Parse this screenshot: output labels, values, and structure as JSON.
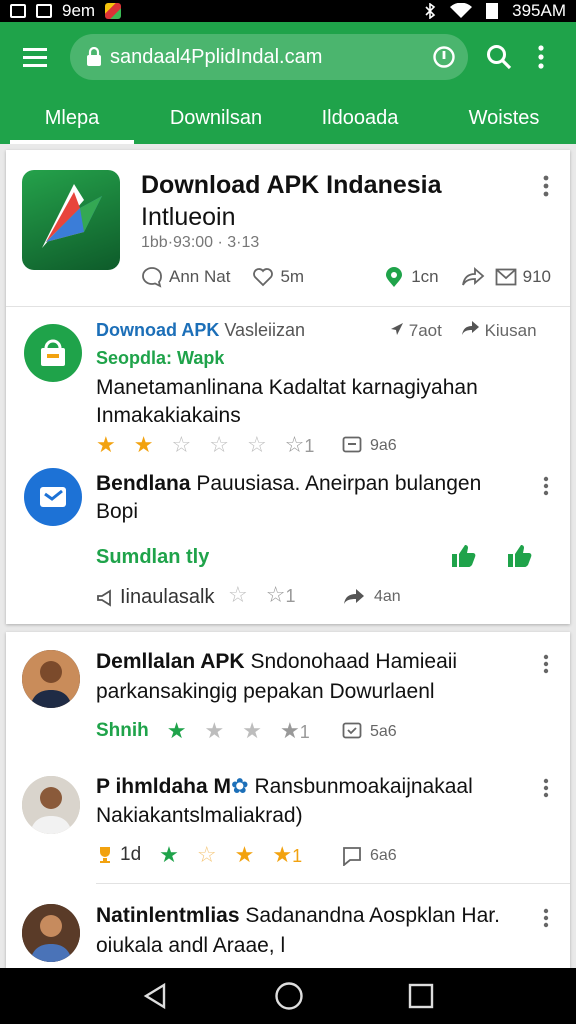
{
  "status": {
    "left_text": "9em",
    "time": "395AM"
  },
  "toolbar": {
    "url": "sandaal4PplidIndal.cam"
  },
  "tabs": [
    {
      "label": "Mlepa"
    },
    {
      "label": "Downilsan"
    },
    {
      "label": "Ildooada"
    },
    {
      "label": "Woistes"
    }
  ],
  "featured": {
    "title": "Download APK  Indanesia",
    "subtitle": "Intlueoin",
    "meta": "1bb·93:00 · 3·13",
    "actions": {
      "author": "Ann Nat",
      "likes": "5m",
      "comments": "1cn",
      "shares": "910"
    }
  },
  "feed": [
    {
      "source": "Downoad APK",
      "source_rest": "Vasleiizan",
      "time": "7aot",
      "action": "Kiusan",
      "tag": "Seopdla: Wapk",
      "body": [
        "Manetamanlinana Kadaltat karnagiyahan",
        "Inmakakiakains"
      ],
      "rating_count": "1",
      "comments": "9a6"
    },
    {
      "title_bold": "Bendlana",
      "title_rest": "Pauusiasa. Aneirpan bulangen",
      "line2": "Bopi",
      "tag": "Sumdlan tly",
      "footer_label": "Iinaulasalk",
      "rating_count": "1",
      "shares": "4an"
    }
  ],
  "posts": [
    {
      "title_bold": "Demllalan APK",
      "title_rest": "Sndonohaad Hamieaii",
      "line2": "parkansakingig pepakan Dowurlaenl",
      "label": "Shnih",
      "rating_count": "1",
      "comments": "5a6"
    },
    {
      "title_bold": "P ihmldaha M",
      "title_rest": "Ransbunmoakaijnakaal",
      "line2": "Nakiakantslmaliakrad)",
      "label": "1d",
      "rating_count": "1",
      "comments": "6a6"
    },
    {
      "title_bold": "Natinlentmlias",
      "title_rest": "Sadanandna Aospklan Har.",
      "line2": "oiukala andl Araae, l"
    }
  ],
  "colors": {
    "brand": "#1fa34a",
    "star": "#f2a20f",
    "link": "#1c6fb8"
  }
}
